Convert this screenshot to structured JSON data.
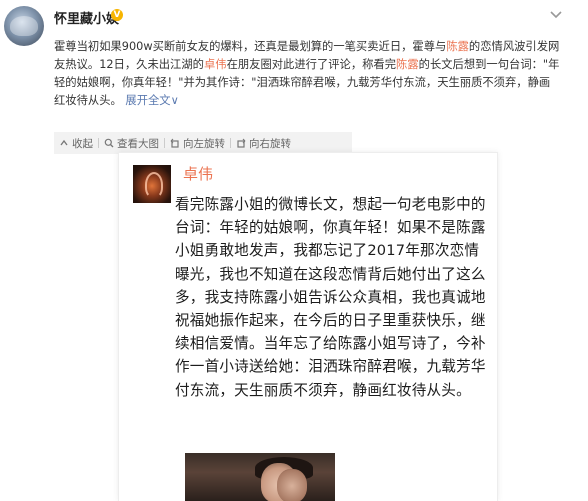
{
  "post": {
    "username": "怀里藏小娱",
    "badge_glyph": "V",
    "body_parts": {
      "p1": "霍尊当初如果900w买断前女友的爆料，还真是最划算的一笔买卖近日，霍尊与",
      "name1": "陈露",
      "p2": "的恋情风波引发网友热议。12日，久未出江湖的",
      "name2": "卓伟",
      "p3": "在朋友圈对此进行了评论，称看完",
      "name3": "陈露",
      "p4": "的长文后想到一句台词：\"年轻的姑娘啊，你真年轻！\"并为其作诗：\"泪洒珠帘醉君喉，九载芳华付东流，天生丽质不须弃，静画红妆待从头。",
      "expand": "展开全文",
      "expand_glyph": "∨"
    },
    "toolbar": {
      "collapse": "收起",
      "view_large": "查看大图",
      "rotate_left": "向左旋转",
      "rotate_right": "向右旋转"
    }
  },
  "embedded_post": {
    "author": "卓伟",
    "text": "看完陈露小姐的微博长文，想起一句老电影中的台词：年轻的姑娘啊，你真年轻！如果不是陈露小姐勇敢地发声，我都忘记了2017年那次恋情曝光，我也不知道在这段恋情背后她付出了这么多，我支持陈露小姐告诉公众真相，我也真诚地祝福她振作起来，在今后的日子里重获快乐，继续相信爱情。当年忘了给陈露小姐写诗了，今补作一首小诗送给她：泪洒珠帘醉君喉，九载芳华付东流，天生丽质不须弃，静画红妆待从头。"
  },
  "icons": [
    "more-icon",
    "collapse-icon",
    "view-large-icon",
    "rotate-left-icon",
    "rotate-right-icon"
  ],
  "colors": {
    "highlight": "#eb7350",
    "link": "#5b7ab0",
    "badge": "#f7b500"
  }
}
